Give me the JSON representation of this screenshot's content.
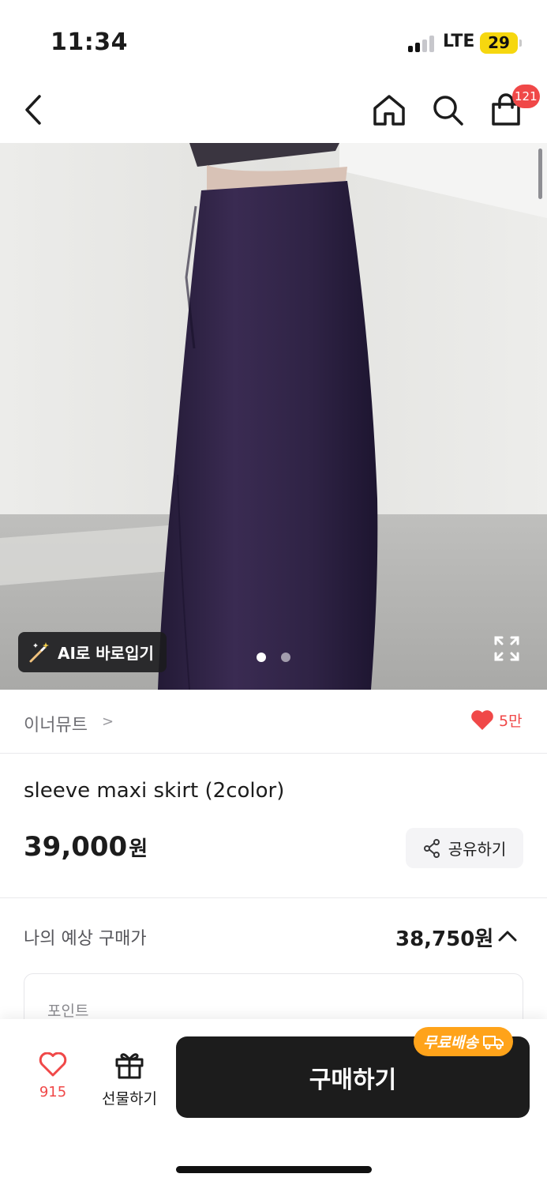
{
  "status_bar": {
    "time": "11:34",
    "network": "LTE",
    "battery": "29"
  },
  "nav": {
    "cart_count": "121"
  },
  "hero": {
    "ai_button_label": "AI로 바로입기",
    "page_count": 2,
    "active_page": 1
  },
  "brand": {
    "name": "이너뮤트",
    "chevron": ">",
    "like_count": "5만"
  },
  "product": {
    "title": "sleeve maxi skirt (2color)",
    "price": "39,000",
    "currency": "원",
    "share_label": "공유하기"
  },
  "expected_price": {
    "label": "나의 예상 구매가",
    "value": "38,750원"
  },
  "points": {
    "label": "포인트"
  },
  "bottom_bar": {
    "wish_count": "915",
    "gift_label": "선물하기",
    "buy_label": "구매하기",
    "free_shipping_label": "무료배송"
  },
  "colors": {
    "accent_red": "#f04848",
    "badge_orange": "#ffa31a",
    "buy_button": "#1c1c1c"
  }
}
